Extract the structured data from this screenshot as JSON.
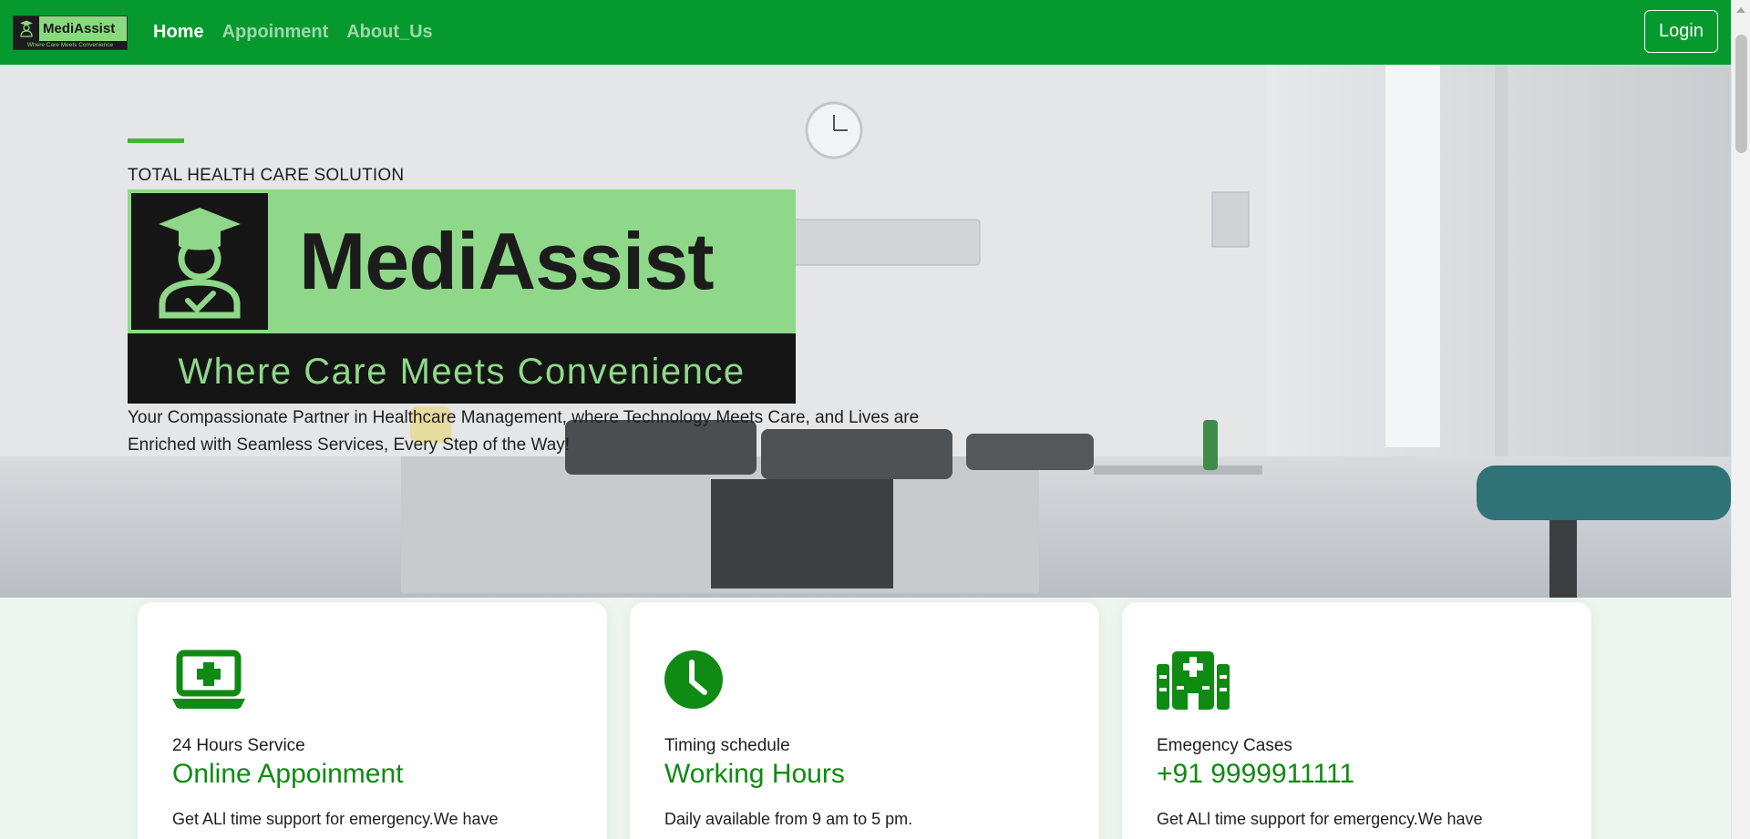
{
  "brand": {
    "name": "MediAssist",
    "tagline": "Where Care Meets Convenience"
  },
  "nav": {
    "items": [
      {
        "label": "Home",
        "active": true
      },
      {
        "label": "Appoinment",
        "active": false
      },
      {
        "label": "About_Us",
        "active": false
      }
    ],
    "login_label": "Login"
  },
  "hero": {
    "kicker": "TOTAL HEALTH CARE SOLUTION",
    "logo_wordmark": "MediAssist",
    "logo_tagline": "Where Care Meets Convenience",
    "description": "Your Compassionate Partner in Healthcare Management, where Technology Meets Care, and Lives are Enriched with Seamless Services, Every Step of the Way!"
  },
  "cards": [
    {
      "icon": "laptop-medical-icon",
      "label": "24 Hours Service",
      "title": "Online Appoinment",
      "text": "Get ALl time support for emergency.We have"
    },
    {
      "icon": "clock-icon",
      "label": "Timing schedule",
      "title": "Working Hours",
      "text": "Daily available from 9 am to 5 pm."
    },
    {
      "icon": "hospital-icon",
      "label": "Emegency Cases",
      "title": "+91 9999911111",
      "text": "Get ALl time support for emergency.We have"
    }
  ],
  "colors": {
    "navbar": "#069a2e",
    "accent_green": "#0f8a12",
    "logo_green": "#8fd88a"
  }
}
